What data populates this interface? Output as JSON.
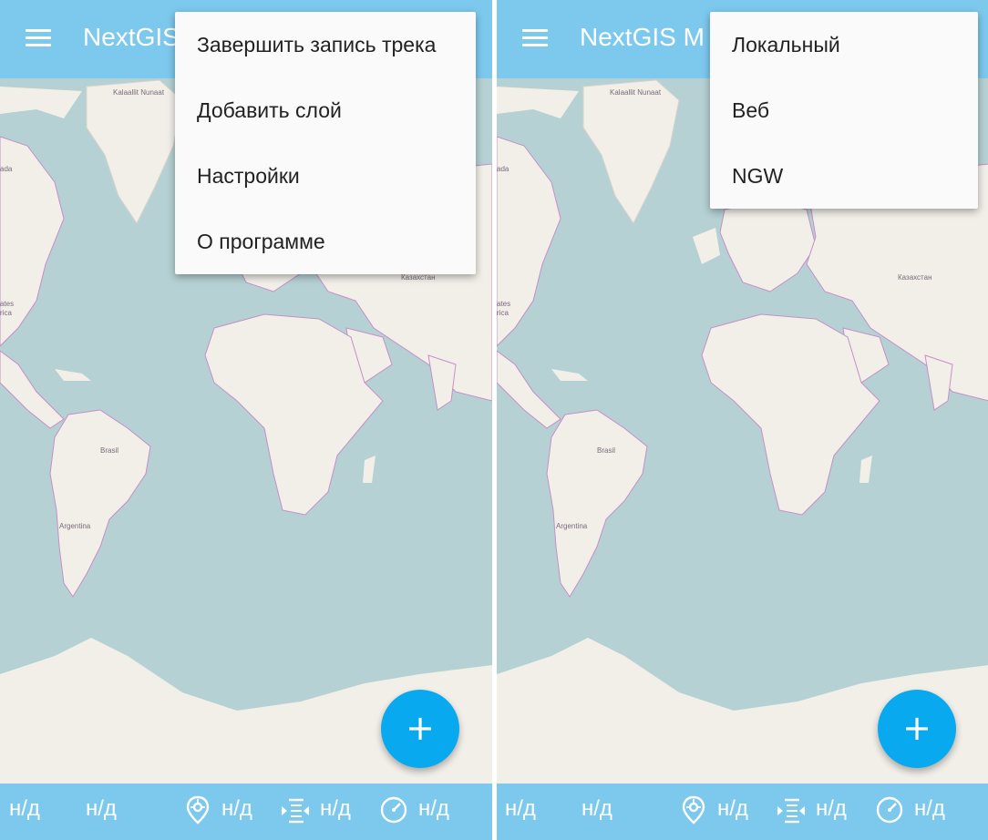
{
  "panels": [
    {
      "app_title": "NextGIS",
      "menu_items": [
        "Завершить запись трека",
        "Добавить слой",
        "Настройки",
        "О программе"
      ],
      "map_labels": [
        "Kalaallit Nunaat",
        "Brasil",
        "Argentina",
        "Казахстан",
        "ada",
        "ates",
        "rica"
      ],
      "fab_label": "+",
      "status": {
        "lat": "н/д",
        "lon": "н/д",
        "accuracy": "н/д",
        "altitude": "н/д",
        "speed": "н/д"
      }
    },
    {
      "app_title": "NextGIS M",
      "menu_items": [
        "Локальный",
        "Веб",
        "NGW"
      ],
      "map_labels": [
        "Kalaallit Nunaat",
        "Brasil",
        "Argentina",
        "Казахстан",
        "ada",
        "ates",
        "rica"
      ],
      "fab_label": "+",
      "status": {
        "lat": "н/д",
        "lon": "н/д",
        "accuracy": "н/д",
        "altitude": "н/д",
        "speed": "н/д"
      }
    }
  ],
  "colors": {
    "appbar": "#7dc9ee",
    "fab": "#08a9ee",
    "ocean": "#b6d1d3",
    "land": "#f2efe9",
    "borders": "#c58fc8"
  },
  "icons": [
    "menu-icon",
    "add-icon",
    "location-pin-icon",
    "altitude-icon",
    "speedometer-icon"
  ]
}
